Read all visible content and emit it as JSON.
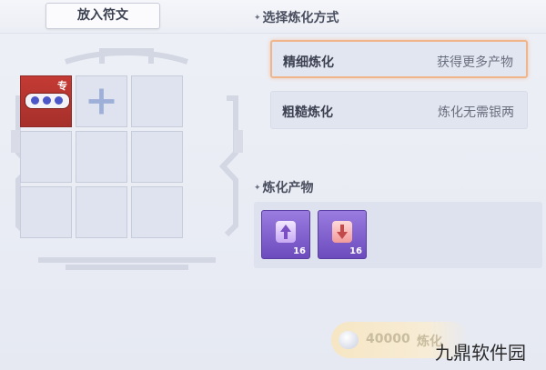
{
  "tabs": {
    "put_rune": "放入符文"
  },
  "method_section": {
    "title": "选择炼化方式",
    "options": [
      {
        "label": "精细炼化",
        "desc": "获得更多产物",
        "selected": true
      },
      {
        "label": "粗糙炼化",
        "desc": "炼化无需银两",
        "selected": false
      }
    ]
  },
  "product_section": {
    "title": "炼化产物",
    "items": [
      {
        "icon": "purple-up-crystal-icon",
        "count": "16"
      },
      {
        "icon": "pink-down-crystal-icon",
        "count": "16"
      }
    ]
  },
  "grid": {
    "rune_tag": "专",
    "slots": 9
  },
  "refine_button": {
    "cost": "40000",
    "label": "炼化"
  },
  "watermark": "九鼎软件园",
  "colors": {
    "accent": "#f0b58a",
    "rune": "#c43a34",
    "product": "#7b5bcf"
  }
}
